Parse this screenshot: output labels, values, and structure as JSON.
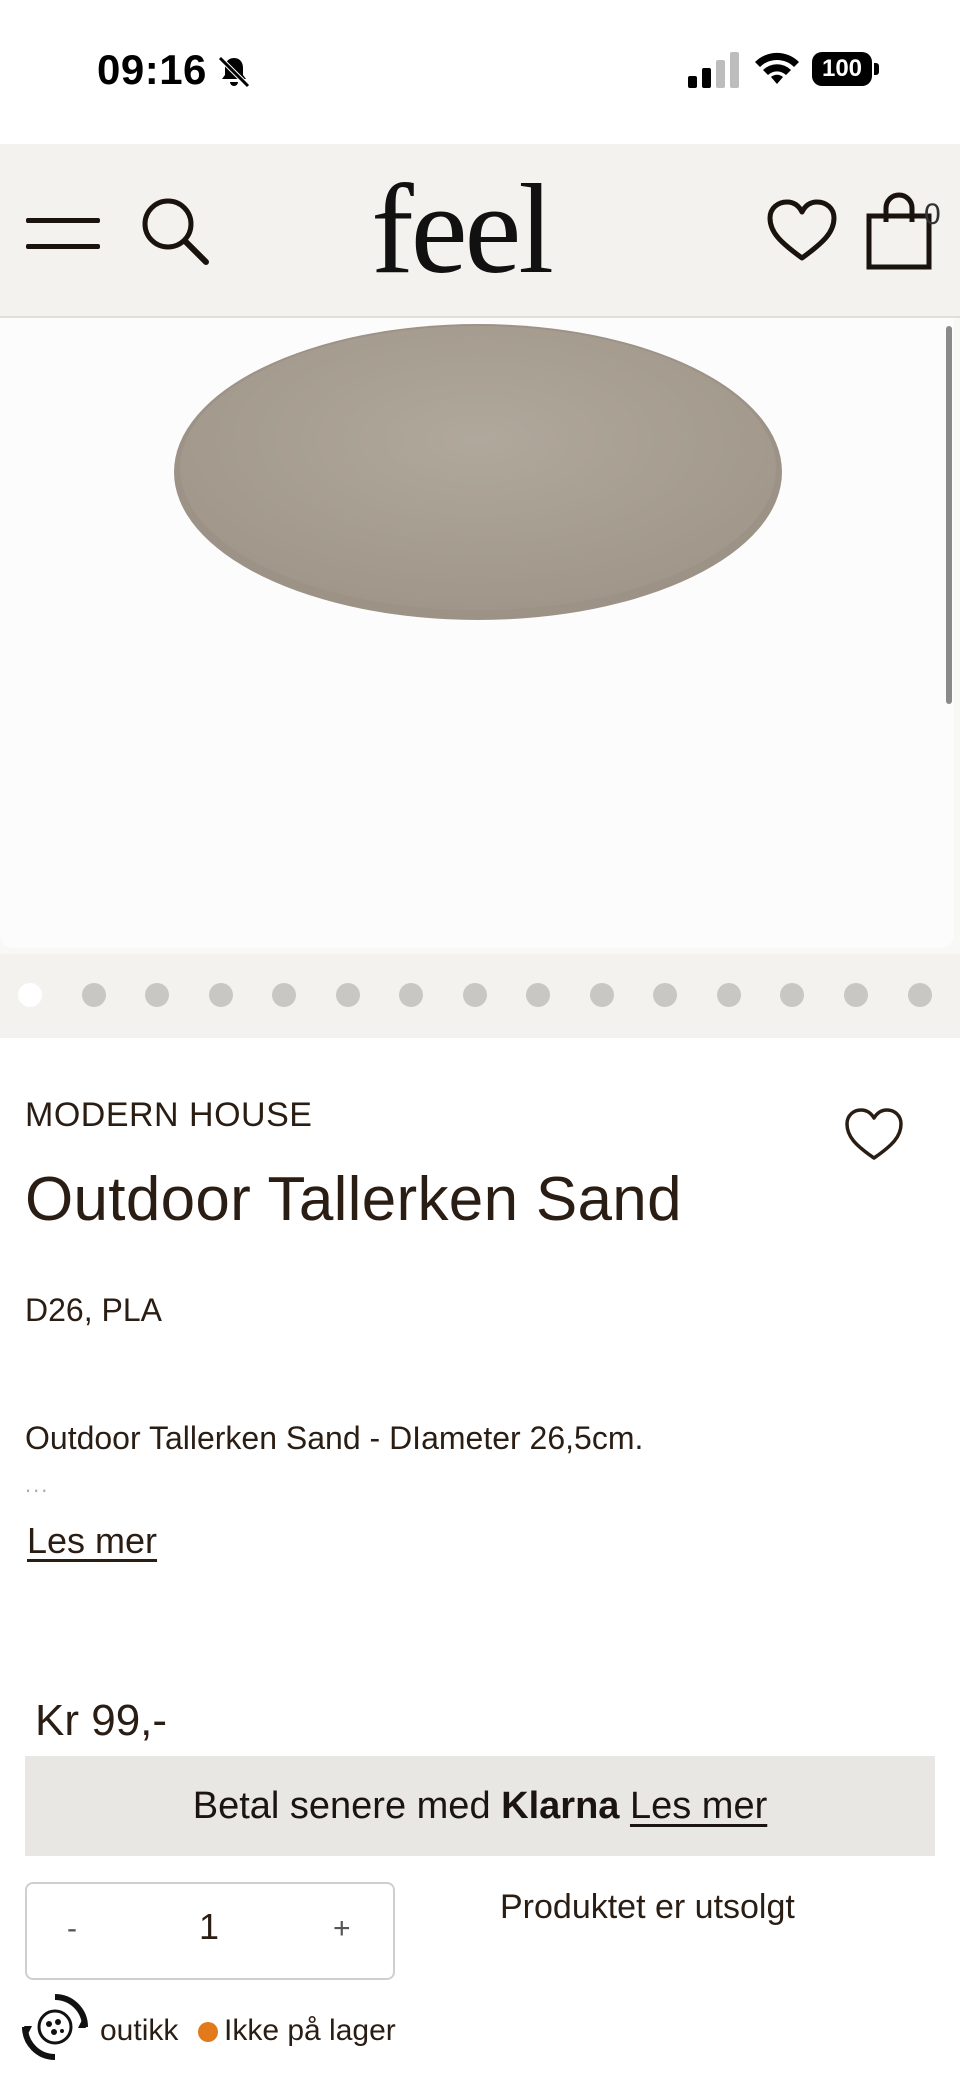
{
  "status_bar": {
    "time": "09:16",
    "battery": "100"
  },
  "header": {
    "logo": "feel",
    "cart_count": "0",
    "icons": [
      "menu-icon",
      "search-icon",
      "heart-icon",
      "shopping-bag-icon"
    ]
  },
  "gallery": {
    "image": "plate-sand",
    "dot_count": 15,
    "active_index": 0
  },
  "product": {
    "brand": "MODERN HOUSE",
    "title": "Outdoor Tallerken Sand",
    "spec": "D26, PLA",
    "description": "Outdoor Tallerken Sand - DIameter 26,5cm.",
    "ellipsis": "...",
    "read_more": "Les mer",
    "price": "Kr 99,-"
  },
  "klarna": {
    "prefix": "Betal senere med",
    "brand": "Klarna",
    "link": "Les mer"
  },
  "quantity": {
    "minus": "-",
    "value": "1",
    "plus": "+"
  },
  "availability": {
    "sold_out": "Produktet er utsolgt",
    "store_label": "outikk",
    "stock_status": "Ikke på lager",
    "stock_color": "#e27a1b"
  },
  "colors": {
    "header_bg": "#f4f2ee",
    "text": "#2a1d14",
    "klarna_bg": "#e9e7e4",
    "plate": "#a89f93"
  }
}
